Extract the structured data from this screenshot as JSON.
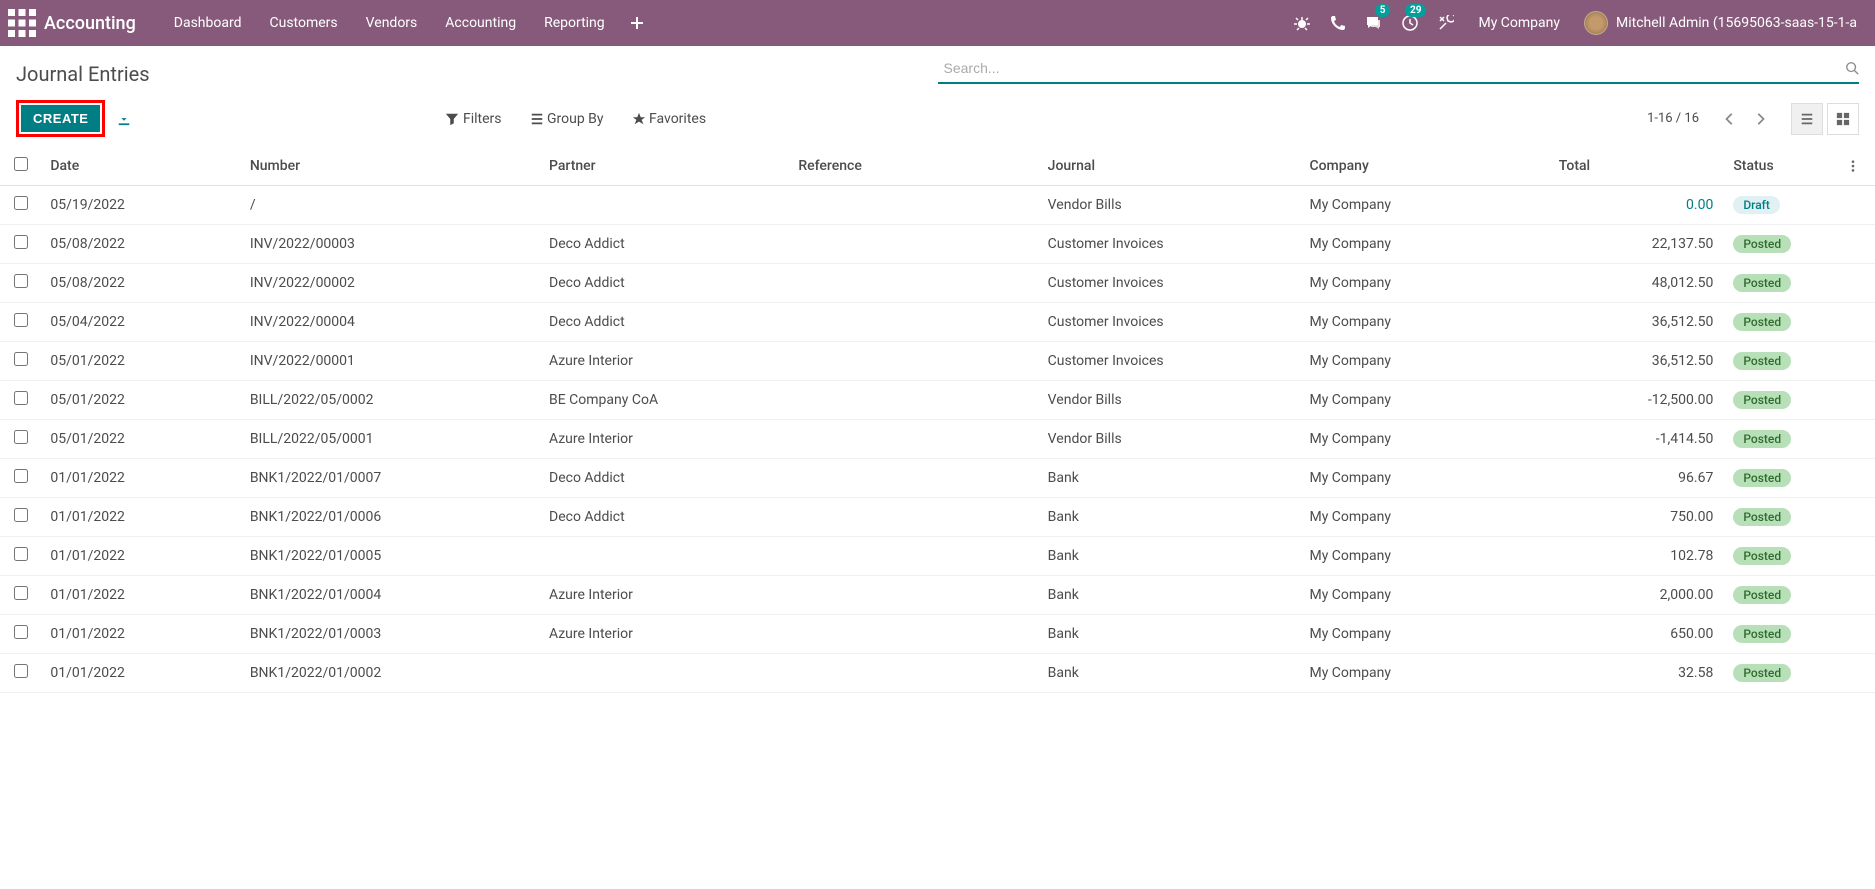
{
  "topnav": {
    "app_name": "Accounting",
    "menus": [
      "Dashboard",
      "Customers",
      "Vendors",
      "Accounting",
      "Reporting"
    ],
    "messages_badge": "5",
    "activities_badge": "29",
    "company": "My Company",
    "username": "Mitchell Admin (15695063-saas-15-1-a"
  },
  "control": {
    "title": "Journal Entries",
    "search_placeholder": "Search...",
    "create_label": "CREATE",
    "filters_label": "Filters",
    "groupby_label": "Group By",
    "favorites_label": "Favorites",
    "pager": "1-16 / 16"
  },
  "columns": {
    "date": "Date",
    "number": "Number",
    "partner": "Partner",
    "reference": "Reference",
    "journal": "Journal",
    "company": "Company",
    "total": "Total",
    "status": "Status"
  },
  "rows": [
    {
      "date": "05/19/2022",
      "number": "/",
      "partner": "",
      "reference": "",
      "journal": "Vendor Bills",
      "company": "My Company",
      "total": "0.00",
      "status": "Draft",
      "draft": true
    },
    {
      "date": "05/08/2022",
      "number": "INV/2022/00003",
      "partner": "Deco Addict",
      "reference": "",
      "journal": "Customer Invoices",
      "company": "My Company",
      "total": "22,137.50",
      "status": "Posted"
    },
    {
      "date": "05/08/2022",
      "number": "INV/2022/00002",
      "partner": "Deco Addict",
      "reference": "",
      "journal": "Customer Invoices",
      "company": "My Company",
      "total": "48,012.50",
      "status": "Posted"
    },
    {
      "date": "05/04/2022",
      "number": "INV/2022/00004",
      "partner": "Deco Addict",
      "reference": "",
      "journal": "Customer Invoices",
      "company": "My Company",
      "total": "36,512.50",
      "status": "Posted"
    },
    {
      "date": "05/01/2022",
      "number": "INV/2022/00001",
      "partner": "Azure Interior",
      "reference": "",
      "journal": "Customer Invoices",
      "company": "My Company",
      "total": "36,512.50",
      "status": "Posted"
    },
    {
      "date": "05/01/2022",
      "number": "BILL/2022/05/0002",
      "partner": "BE Company CoA",
      "reference": "",
      "journal": "Vendor Bills",
      "company": "My Company",
      "total": "-12,500.00",
      "status": "Posted"
    },
    {
      "date": "05/01/2022",
      "number": "BILL/2022/05/0001",
      "partner": "Azure Interior",
      "reference": "",
      "journal": "Vendor Bills",
      "company": "My Company",
      "total": "-1,414.50",
      "status": "Posted"
    },
    {
      "date": "01/01/2022",
      "number": "BNK1/2022/01/0007",
      "partner": "Deco Addict",
      "reference": "",
      "journal": "Bank",
      "company": "My Company",
      "total": "96.67",
      "status": "Posted"
    },
    {
      "date": "01/01/2022",
      "number": "BNK1/2022/01/0006",
      "partner": "Deco Addict",
      "reference": "",
      "journal": "Bank",
      "company": "My Company",
      "total": "750.00",
      "status": "Posted"
    },
    {
      "date": "01/01/2022",
      "number": "BNK1/2022/01/0005",
      "partner": "",
      "reference": "",
      "journal": "Bank",
      "company": "My Company",
      "total": "102.78",
      "status": "Posted"
    },
    {
      "date": "01/01/2022",
      "number": "BNK1/2022/01/0004",
      "partner": "Azure Interior",
      "reference": "",
      "journal": "Bank",
      "company": "My Company",
      "total": "2,000.00",
      "status": "Posted"
    },
    {
      "date": "01/01/2022",
      "number": "BNK1/2022/01/0003",
      "partner": "Azure Interior",
      "reference": "",
      "journal": "Bank",
      "company": "My Company",
      "total": "650.00",
      "status": "Posted"
    },
    {
      "date": "01/01/2022",
      "number": "BNK1/2022/01/0002",
      "partner": "",
      "reference": "",
      "journal": "Bank",
      "company": "My Company",
      "total": "32.58",
      "status": "Posted"
    }
  ]
}
